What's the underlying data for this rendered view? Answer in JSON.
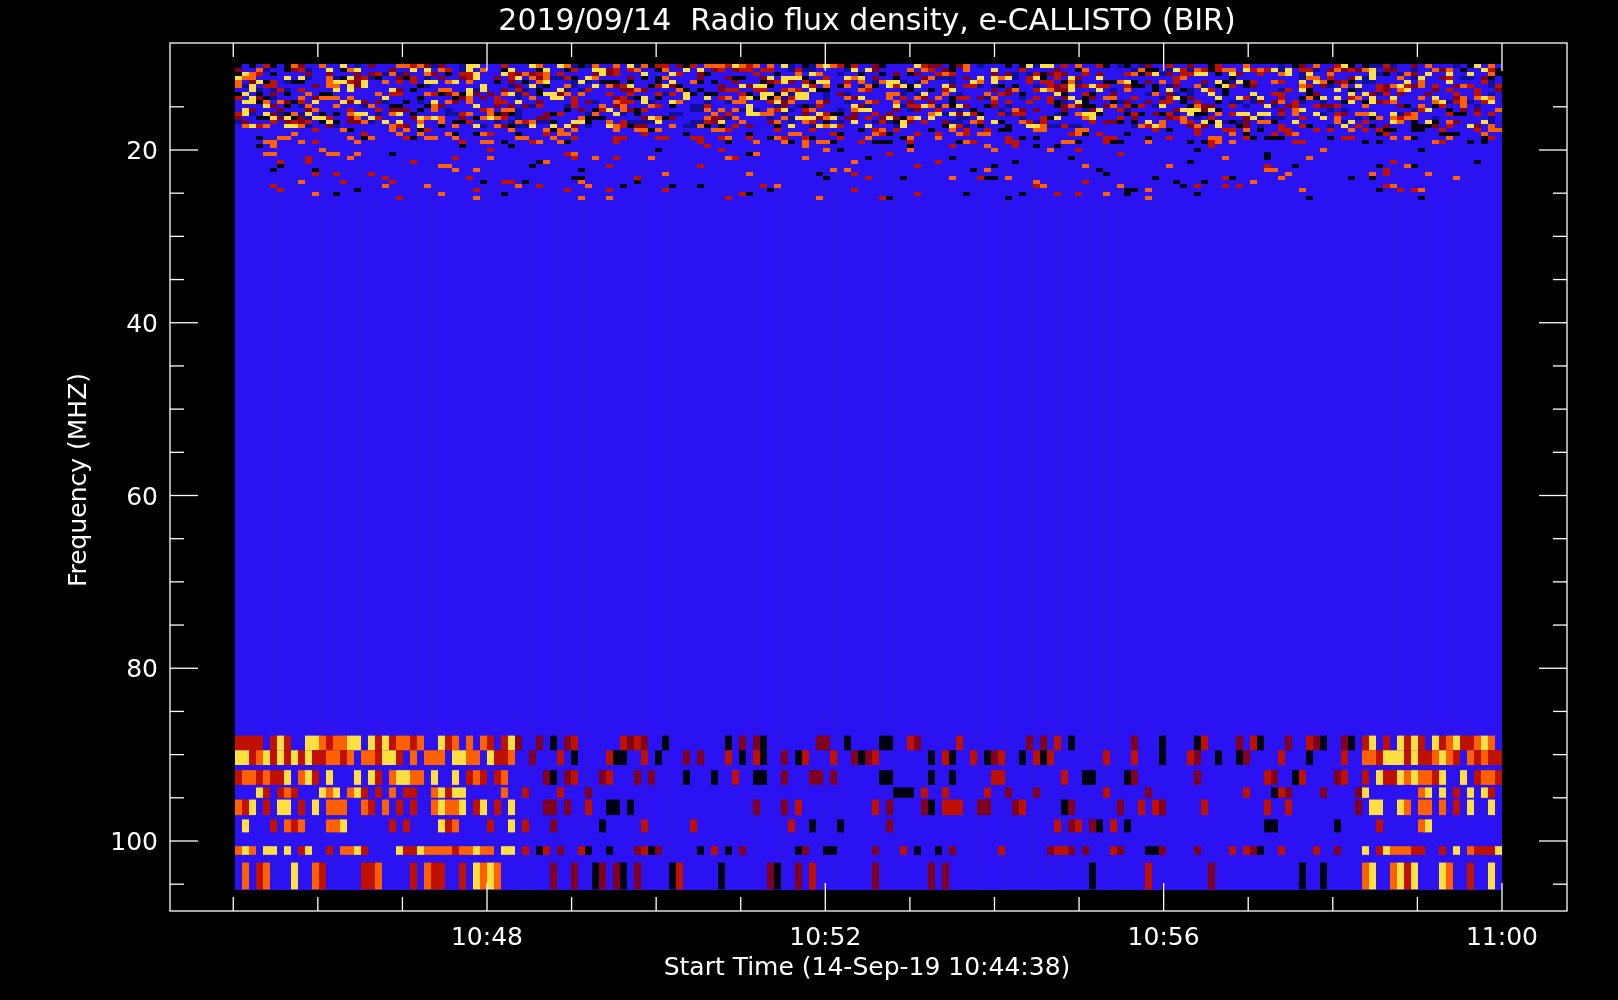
{
  "title": "2019/09/14  Radio flux density, e-CALLISTO (BIR)",
  "y_axis": {
    "label": "Frequency (MHZ)",
    "ticks": [
      "20",
      "40",
      "60",
      "80",
      "100"
    ]
  },
  "x_axis": {
    "label": "Start Time (14-Sep-19 10:44:38)",
    "ticks": [
      "10:48",
      "10:52",
      "10:56",
      "11:00"
    ]
  }
}
